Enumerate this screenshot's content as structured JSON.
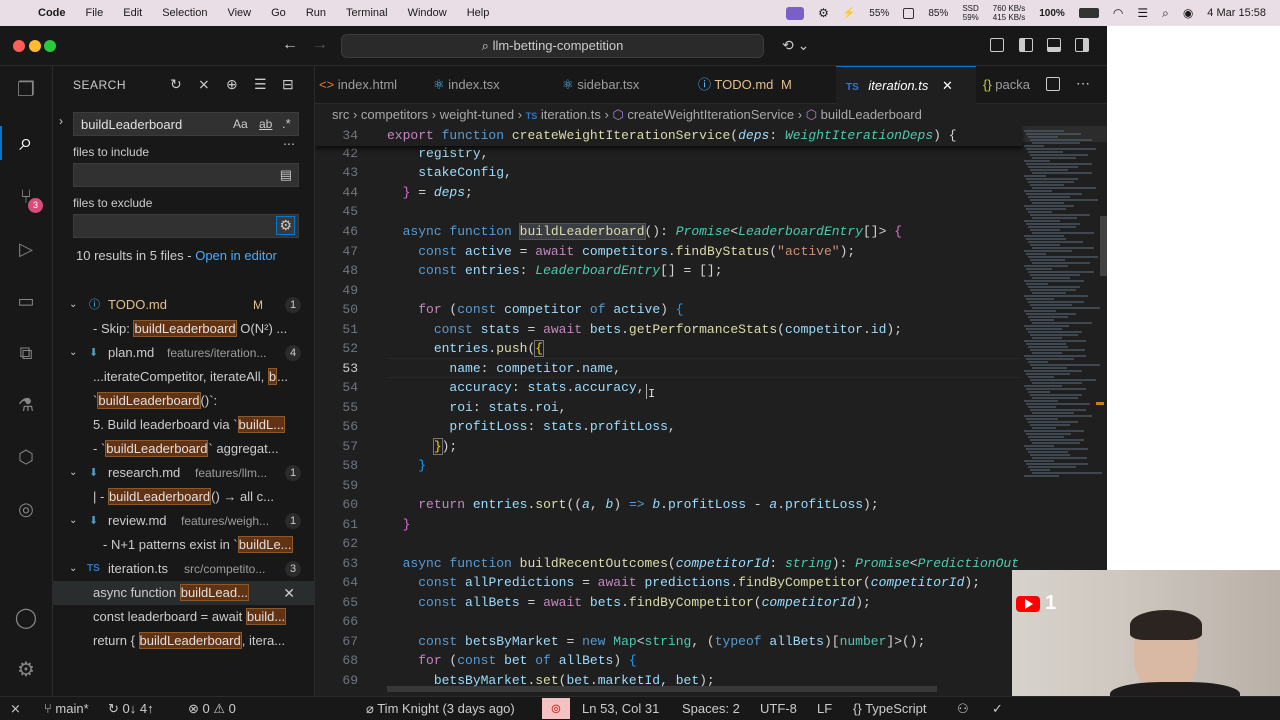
{
  "menubar": {
    "app_name": "Code",
    "items": [
      "File",
      "Edit",
      "Selection",
      "View",
      "Go",
      "Run",
      "Terminal",
      "Window",
      "Help"
    ],
    "cpu": "55%",
    "gpu": "85%",
    "ssd_label": "SSD",
    "ssd": "59%",
    "net_up": "760 KB/s",
    "net_down": "415 KB/s",
    "battery": "100%",
    "datetime": "4 Mar  15:58"
  },
  "window": {
    "search_title": "llm-betting-competition"
  },
  "activity": {
    "scm_badge": "3"
  },
  "sidebar": {
    "title": "SEARCH",
    "search_value": "buildLeaderboard",
    "opt_case": "Aa",
    "opt_word": "ab",
    "opt_regex": ".*",
    "files_include_label": "files to include",
    "files_exclude_label": "files to exclude",
    "results_summary": "10 results in 5 files - ",
    "open_in_editor": "Open in editor",
    "results": [
      {
        "file": "TODO.md",
        "path": "",
        "status": "M",
        "count": "1",
        "matches": [
          {
            "pre": "- Skip: ",
            "hit": "buildLeaderboard",
            "post": " O(N²) ..."
          }
        ]
      },
      {
        "file": "plan.md",
        "path": "features/iteration...",
        "status": "",
        "count": "4",
        "matches": [
          {
            "pre": "...iterateCompetitor, iterateAll, ",
            "hit": "b",
            "post": "..."
          },
          {
            "pre": "`",
            "hit": "buildLeaderboard",
            "post": "()`:"
          },
          {
            "pre": "5. Build leaderboard via `",
            "hit": "buildL...",
            "post": ""
          },
          {
            "pre": "- `",
            "hit": "buildLeaderboard",
            "post": "` aggregat..."
          }
        ]
      },
      {
        "file": "research.md",
        "path": "features/llm...",
        "status": "",
        "count": "1",
        "matches": [
          {
            "pre": "|   - ",
            "hit": "buildLeaderboard",
            "post": "() → all c..."
          }
        ]
      },
      {
        "file": "review.md",
        "path": "features/weigh...",
        "status": "",
        "count": "1",
        "matches": [
          {
            "pre": "- N+1 patterns exist in `",
            "hit": "buildLe...",
            "post": ""
          }
        ]
      },
      {
        "file": "iteration.ts",
        "path": "src/competito...",
        "status": "",
        "count": "3",
        "matches": [
          {
            "pre": "async function ",
            "hit": "buildLead...",
            "post": ""
          },
          {
            "pre": "const leaderboard = await ",
            "hit": "build...",
            "post": ""
          },
          {
            "pre": "return { ",
            "hit": "buildLeaderboard",
            "post": ", itera..."
          }
        ]
      }
    ]
  },
  "tabs": [
    {
      "label": "index.html",
      "icon": "html-icon",
      "color": "#e37933",
      "mark": ""
    },
    {
      "label": "index.tsx",
      "icon": "react-icon",
      "color": "#4fc1ff",
      "mark": ""
    },
    {
      "label": "sidebar.tsx",
      "icon": "react-icon",
      "color": "#4fc1ff",
      "mark": ""
    },
    {
      "label": "TODO.md",
      "icon": "info-icon",
      "color": "#4fc1ff",
      "mark": "M"
    },
    {
      "label": "iteration.ts",
      "icon": "ts-icon",
      "color": "#3178c6",
      "mark": "",
      "active": true
    },
    {
      "label": "packa",
      "icon": "braces-icon",
      "color": "#cbcb41",
      "mark": ""
    }
  ],
  "tab_ts_badge": "TS",
  "breadcrumbs": [
    "src",
    "competitors",
    "weight-tuned",
    "iteration.ts",
    "createWeightIterationService",
    "buildLeaderboard"
  ],
  "editor": {
    "line_numbers": [
      "34",
      "42",
      "43",
      "44",
      "45",
      "46",
      "47",
      "48",
      "49",
      "50",
      "51",
      "52",
      "53",
      "54",
      "55",
      "56",
      "57",
      "58",
      "59",
      "60",
      "61",
      "62",
      "63",
      "64",
      "65",
      "66",
      "67",
      "68",
      "69"
    ],
    "sticky_line": "34"
  },
  "statusbar": {
    "branch": "main*",
    "sync": "0↓ 4↑",
    "errors": "0",
    "warnings": "0",
    "blame": "Tim Knight (3 days ago)",
    "position": "Ln 53, Col 31",
    "spaces": "Spaces: 2",
    "encoding": "UTF-8",
    "eol": "LF",
    "language": "TypeScript"
  },
  "webcam": {
    "badge": "1"
  }
}
